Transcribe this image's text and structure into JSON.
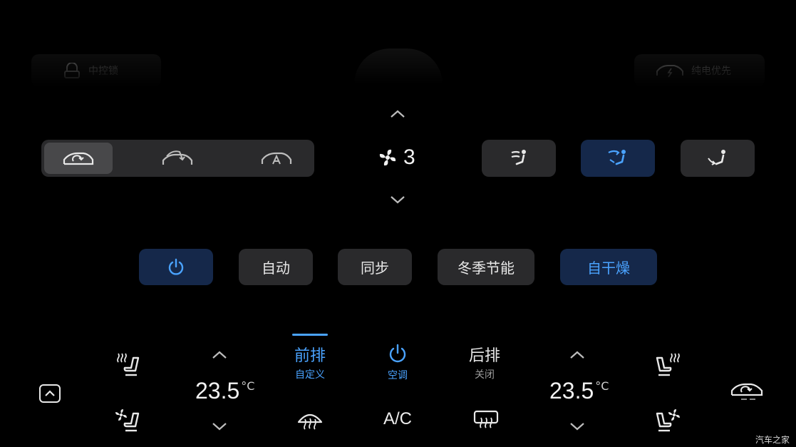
{
  "top": {
    "central_lock_label": "中控锁",
    "ev_priority_label": "纯电优先"
  },
  "recirculation": {
    "items": [
      "inner-circulation",
      "outer-circulation",
      "auto-circulation"
    ],
    "selected_index": 0
  },
  "fan": {
    "level": "3"
  },
  "airflow_modes": {
    "items": [
      "face",
      "face-and-feet",
      "feet"
    ],
    "selected_index": 1
  },
  "functions": {
    "power_label": "",
    "auto_label": "自动",
    "sync_label": "同步",
    "winter_eco_label": "冬季节能",
    "self_dry_label": "自干燥",
    "power_active": true,
    "self_dry_active": true
  },
  "bottom": {
    "left_temp": "23.5",
    "right_temp": "23.5",
    "temp_unit": "°C",
    "front_title": "前排",
    "front_sub": "自定义",
    "ac_power_label": "空调",
    "rear_title": "后排",
    "rear_sub": "关闭",
    "ac_label": "A/C"
  },
  "colors": {
    "accent": "#4aa3ff",
    "active_bg": "#15284a",
    "button_bg": "#2a2a2c"
  },
  "watermark": "汽车之家"
}
